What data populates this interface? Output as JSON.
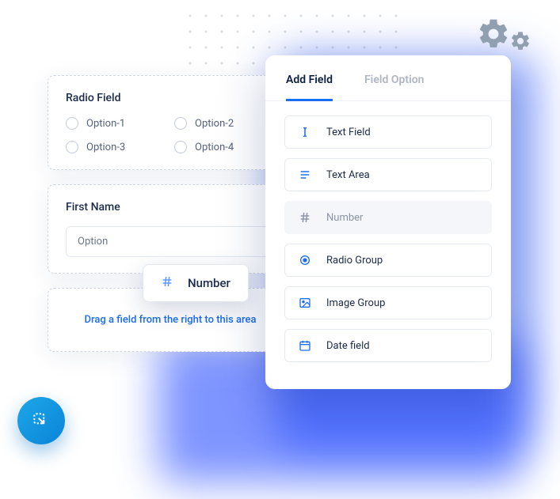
{
  "left": {
    "radio_card": {
      "title": "Radio Field",
      "options": [
        "Option-1",
        "Option-2",
        "Option-3",
        "Option-4"
      ]
    },
    "name_card": {
      "title": "First Name",
      "input_value": "Option"
    },
    "dropzone": {
      "text": "Drag a field from the right to this area"
    }
  },
  "drag_chip": {
    "label": "Number",
    "icon": "hash-icon"
  },
  "panel": {
    "tabs": {
      "add": "Add Field",
      "option": "Field Option",
      "active": "add"
    },
    "fields": [
      {
        "label": "Text Field",
        "icon": "text-cursor-icon",
        "muted": false
      },
      {
        "label": "Text Area",
        "icon": "text-lines-icon",
        "muted": false
      },
      {
        "label": "Number",
        "icon": "hash-icon",
        "muted": true
      },
      {
        "label": "Radio Group",
        "icon": "radio-icon",
        "muted": false
      },
      {
        "label": "Image Group",
        "icon": "image-icon",
        "muted": false
      },
      {
        "label": "Date field",
        "icon": "calendar-icon",
        "muted": false
      }
    ]
  },
  "fab": {
    "icon": "collapse-icon"
  },
  "decor": {
    "icon": "gear-icon"
  }
}
